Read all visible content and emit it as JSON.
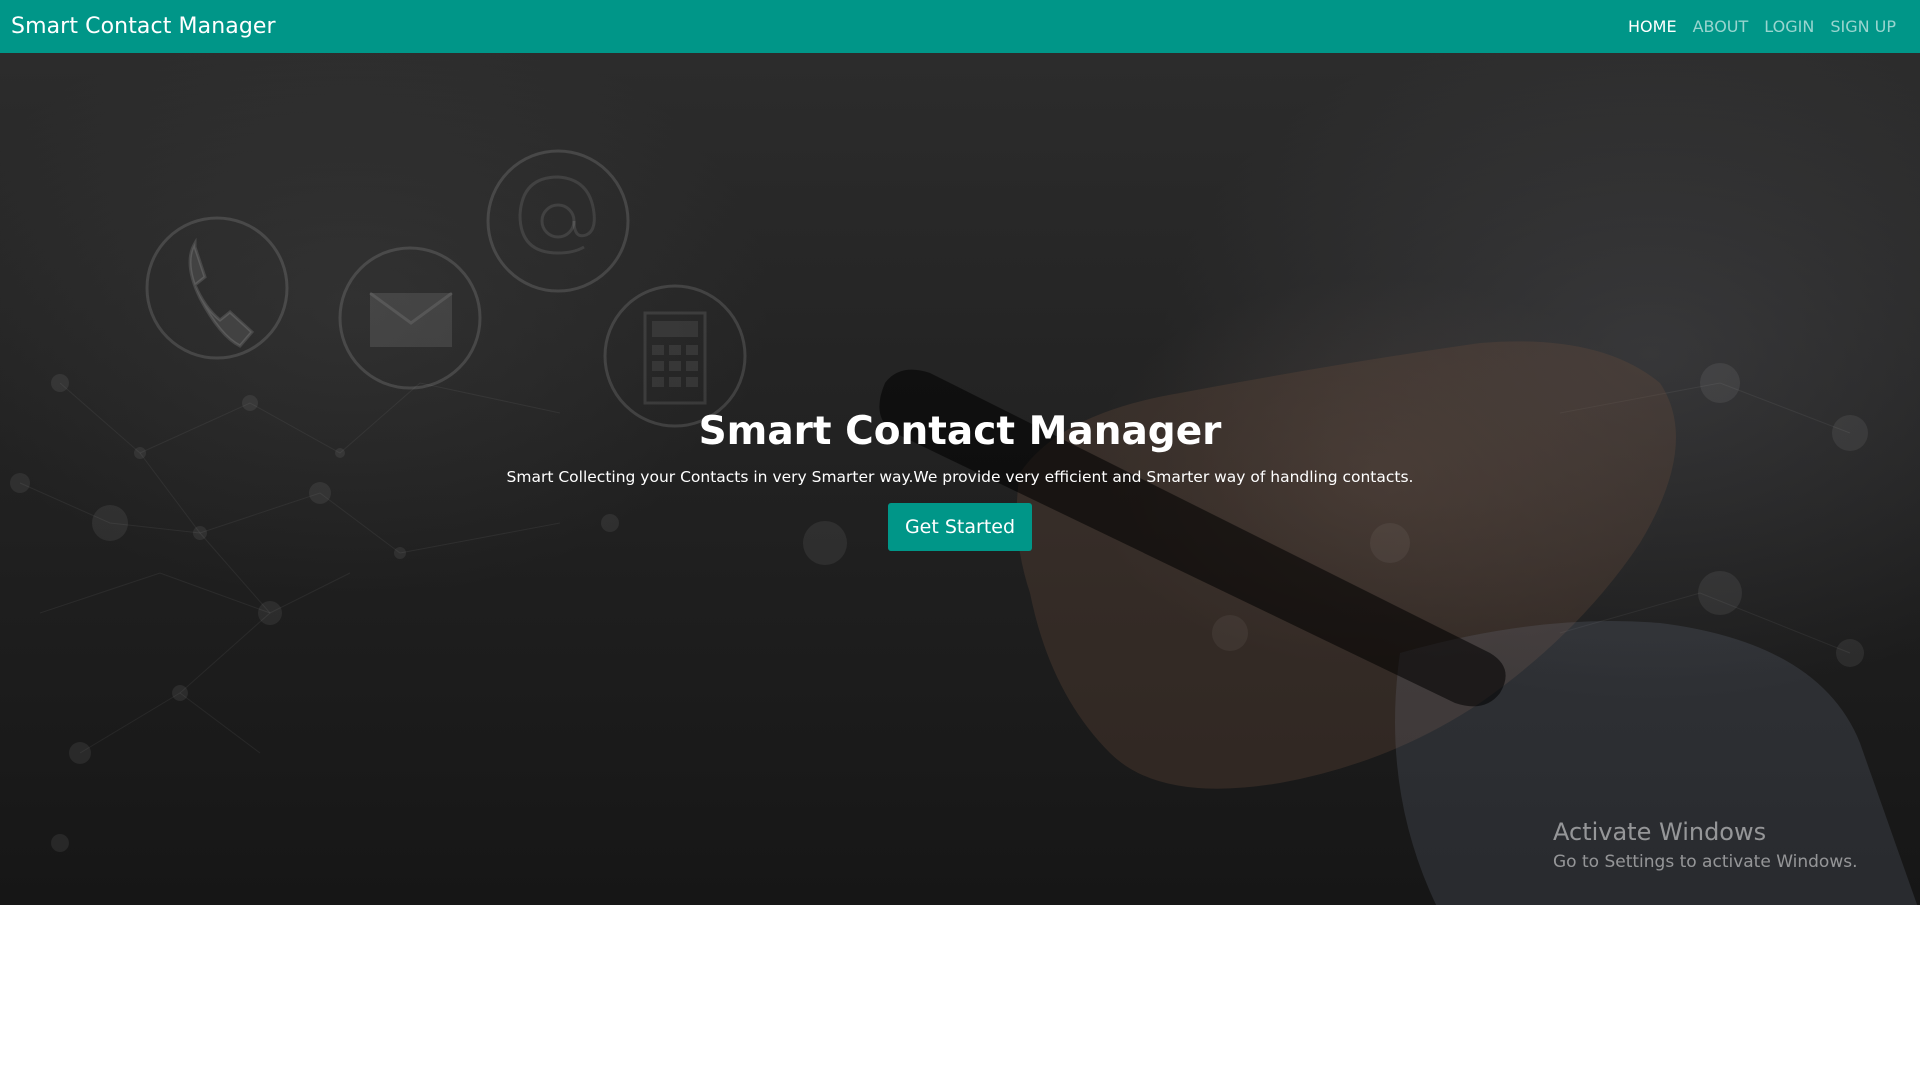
{
  "navbar": {
    "brand": "Smart Contact Manager",
    "links": [
      {
        "label": "HOME",
        "active": true
      },
      {
        "label": "ABOUT",
        "active": false
      },
      {
        "label": "LOGIN",
        "active": false
      },
      {
        "label": "SIGN UP",
        "active": false
      }
    ]
  },
  "hero": {
    "title": "Smart Contact Manager",
    "subtitle": "Smart Collecting your Contacts in very Smarter way.We provide very efficient and Smarter way of handling contacts.",
    "cta_label": "Get Started",
    "background_icons": [
      "phone-icon",
      "envelope-icon",
      "at-sign-icon",
      "calculator-icon"
    ]
  },
  "watermark": {
    "title": "Activate Windows",
    "subtitle": "Go to Settings to activate Windows."
  },
  "colors": {
    "accent": "#009688",
    "hero_dark": "#1e1e1e"
  }
}
